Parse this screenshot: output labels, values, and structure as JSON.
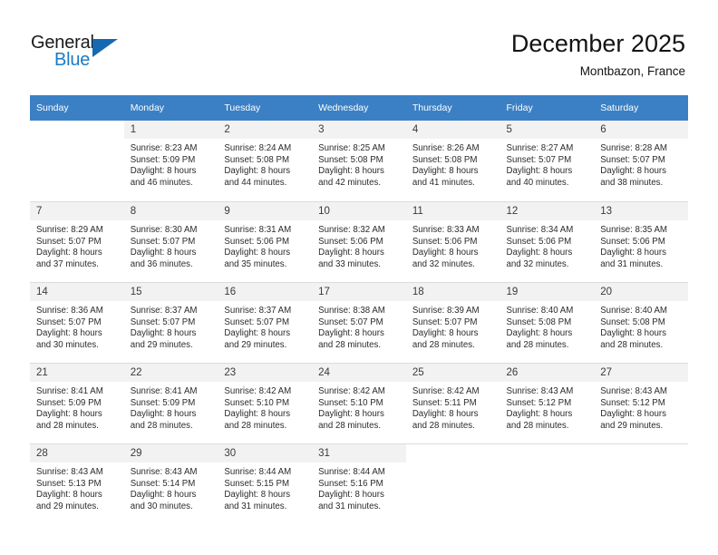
{
  "brand": {
    "name_part1": "General",
    "name_part2": "Blue",
    "triangle_icon": "triangle-icon",
    "color_dark": "#1a1a1a",
    "color_blue": "#1b7ac4"
  },
  "header": {
    "title": "December 2025",
    "subtitle": "Montbazon, France"
  },
  "theme": {
    "header_row_bg": "#3b80c4",
    "daynum_bg": "#f2f2f2",
    "grid_line": "#dcdcdc"
  },
  "weekdays": [
    "Sunday",
    "Monday",
    "Tuesday",
    "Wednesday",
    "Thursday",
    "Friday",
    "Saturday"
  ],
  "weeks": [
    [
      {
        "day": "",
        "empty": true,
        "blank": true,
        "sunrise": "",
        "sunset": "",
        "daylight1": "",
        "daylight2": ""
      },
      {
        "day": "1",
        "sunrise": "Sunrise: 8:23 AM",
        "sunset": "Sunset: 5:09 PM",
        "daylight1": "Daylight: 8 hours",
        "daylight2": "and 46 minutes."
      },
      {
        "day": "2",
        "sunrise": "Sunrise: 8:24 AM",
        "sunset": "Sunset: 5:08 PM",
        "daylight1": "Daylight: 8 hours",
        "daylight2": "and 44 minutes."
      },
      {
        "day": "3",
        "sunrise": "Sunrise: 8:25 AM",
        "sunset": "Sunset: 5:08 PM",
        "daylight1": "Daylight: 8 hours",
        "daylight2": "and 42 minutes."
      },
      {
        "day": "4",
        "sunrise": "Sunrise: 8:26 AM",
        "sunset": "Sunset: 5:08 PM",
        "daylight1": "Daylight: 8 hours",
        "daylight2": "and 41 minutes."
      },
      {
        "day": "5",
        "sunrise": "Sunrise: 8:27 AM",
        "sunset": "Sunset: 5:07 PM",
        "daylight1": "Daylight: 8 hours",
        "daylight2": "and 40 minutes."
      },
      {
        "day": "6",
        "sunrise": "Sunrise: 8:28 AM",
        "sunset": "Sunset: 5:07 PM",
        "daylight1": "Daylight: 8 hours",
        "daylight2": "and 38 minutes."
      }
    ],
    [
      {
        "day": "7",
        "sunrise": "Sunrise: 8:29 AM",
        "sunset": "Sunset: 5:07 PM",
        "daylight1": "Daylight: 8 hours",
        "daylight2": "and 37 minutes."
      },
      {
        "day": "8",
        "sunrise": "Sunrise: 8:30 AM",
        "sunset": "Sunset: 5:07 PM",
        "daylight1": "Daylight: 8 hours",
        "daylight2": "and 36 minutes."
      },
      {
        "day": "9",
        "sunrise": "Sunrise: 8:31 AM",
        "sunset": "Sunset: 5:06 PM",
        "daylight1": "Daylight: 8 hours",
        "daylight2": "and 35 minutes."
      },
      {
        "day": "10",
        "sunrise": "Sunrise: 8:32 AM",
        "sunset": "Sunset: 5:06 PM",
        "daylight1": "Daylight: 8 hours",
        "daylight2": "and 33 minutes."
      },
      {
        "day": "11",
        "sunrise": "Sunrise: 8:33 AM",
        "sunset": "Sunset: 5:06 PM",
        "daylight1": "Daylight: 8 hours",
        "daylight2": "and 32 minutes."
      },
      {
        "day": "12",
        "sunrise": "Sunrise: 8:34 AM",
        "sunset": "Sunset: 5:06 PM",
        "daylight1": "Daylight: 8 hours",
        "daylight2": "and 32 minutes."
      },
      {
        "day": "13",
        "sunrise": "Sunrise: 8:35 AM",
        "sunset": "Sunset: 5:06 PM",
        "daylight1": "Daylight: 8 hours",
        "daylight2": "and 31 minutes."
      }
    ],
    [
      {
        "day": "14",
        "sunrise": "Sunrise: 8:36 AM",
        "sunset": "Sunset: 5:07 PM",
        "daylight1": "Daylight: 8 hours",
        "daylight2": "and 30 minutes."
      },
      {
        "day": "15",
        "sunrise": "Sunrise: 8:37 AM",
        "sunset": "Sunset: 5:07 PM",
        "daylight1": "Daylight: 8 hours",
        "daylight2": "and 29 minutes."
      },
      {
        "day": "16",
        "sunrise": "Sunrise: 8:37 AM",
        "sunset": "Sunset: 5:07 PM",
        "daylight1": "Daylight: 8 hours",
        "daylight2": "and 29 minutes."
      },
      {
        "day": "17",
        "sunrise": "Sunrise: 8:38 AM",
        "sunset": "Sunset: 5:07 PM",
        "daylight1": "Daylight: 8 hours",
        "daylight2": "and 28 minutes."
      },
      {
        "day": "18",
        "sunrise": "Sunrise: 8:39 AM",
        "sunset": "Sunset: 5:07 PM",
        "daylight1": "Daylight: 8 hours",
        "daylight2": "and 28 minutes."
      },
      {
        "day": "19",
        "sunrise": "Sunrise: 8:40 AM",
        "sunset": "Sunset: 5:08 PM",
        "daylight1": "Daylight: 8 hours",
        "daylight2": "and 28 minutes."
      },
      {
        "day": "20",
        "sunrise": "Sunrise: 8:40 AM",
        "sunset": "Sunset: 5:08 PM",
        "daylight1": "Daylight: 8 hours",
        "daylight2": "and 28 minutes."
      }
    ],
    [
      {
        "day": "21",
        "sunrise": "Sunrise: 8:41 AM",
        "sunset": "Sunset: 5:09 PM",
        "daylight1": "Daylight: 8 hours",
        "daylight2": "and 28 minutes."
      },
      {
        "day": "22",
        "sunrise": "Sunrise: 8:41 AM",
        "sunset": "Sunset: 5:09 PM",
        "daylight1": "Daylight: 8 hours",
        "daylight2": "and 28 minutes."
      },
      {
        "day": "23",
        "sunrise": "Sunrise: 8:42 AM",
        "sunset": "Sunset: 5:10 PM",
        "daylight1": "Daylight: 8 hours",
        "daylight2": "and 28 minutes."
      },
      {
        "day": "24",
        "sunrise": "Sunrise: 8:42 AM",
        "sunset": "Sunset: 5:10 PM",
        "daylight1": "Daylight: 8 hours",
        "daylight2": "and 28 minutes."
      },
      {
        "day": "25",
        "sunrise": "Sunrise: 8:42 AM",
        "sunset": "Sunset: 5:11 PM",
        "daylight1": "Daylight: 8 hours",
        "daylight2": "and 28 minutes."
      },
      {
        "day": "26",
        "sunrise": "Sunrise: 8:43 AM",
        "sunset": "Sunset: 5:12 PM",
        "daylight1": "Daylight: 8 hours",
        "daylight2": "and 28 minutes."
      },
      {
        "day": "27",
        "sunrise": "Sunrise: 8:43 AM",
        "sunset": "Sunset: 5:12 PM",
        "daylight1": "Daylight: 8 hours",
        "daylight2": "and 29 minutes."
      }
    ],
    [
      {
        "day": "28",
        "sunrise": "Sunrise: 8:43 AM",
        "sunset": "Sunset: 5:13 PM",
        "daylight1": "Daylight: 8 hours",
        "daylight2": "and 29 minutes."
      },
      {
        "day": "29",
        "sunrise": "Sunrise: 8:43 AM",
        "sunset": "Sunset: 5:14 PM",
        "daylight1": "Daylight: 8 hours",
        "daylight2": "and 30 minutes."
      },
      {
        "day": "30",
        "sunrise": "Sunrise: 8:44 AM",
        "sunset": "Sunset: 5:15 PM",
        "daylight1": "Daylight: 8 hours",
        "daylight2": "and 31 minutes."
      },
      {
        "day": "31",
        "sunrise": "Sunrise: 8:44 AM",
        "sunset": "Sunset: 5:16 PM",
        "daylight1": "Daylight: 8 hours",
        "daylight2": "and 31 minutes."
      },
      {
        "day": "",
        "empty": true,
        "blank": true,
        "sunrise": "",
        "sunset": "",
        "daylight1": "",
        "daylight2": ""
      },
      {
        "day": "",
        "empty": true,
        "blank": true,
        "sunrise": "",
        "sunset": "",
        "daylight1": "",
        "daylight2": ""
      },
      {
        "day": "",
        "empty": true,
        "blank": true,
        "sunrise": "",
        "sunset": "",
        "daylight1": "",
        "daylight2": ""
      }
    ]
  ]
}
